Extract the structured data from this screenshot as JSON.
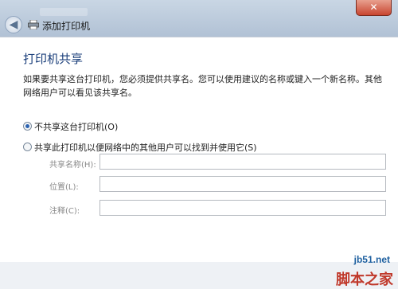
{
  "window": {
    "title_text": "添加打印机",
    "close_symbol": "✕",
    "back_symbol": "◀"
  },
  "page": {
    "heading": "打印机共享",
    "description": "如果要共享这台打印机，您必须提供共享名。您可以使用建议的名称或键入一个新名称。其他网络用户可以看见该共享名。"
  },
  "options": [
    {
      "label": "不共享这台打印机(O)",
      "selected": true
    },
    {
      "label": "共享此打印机以便网络中的其他用户可以找到并使用它(S)",
      "selected": false
    }
  ],
  "fields": {
    "share_name_label": "共享名称(H):",
    "location_label": "位置(L):",
    "comment_label": "注释(C):"
  },
  "watermark": {
    "site": "jb51.net",
    "brand": "脚本之家"
  },
  "icons": {
    "back": "back-arrow-icon",
    "printer": "printer-icon",
    "close": "close-icon"
  }
}
